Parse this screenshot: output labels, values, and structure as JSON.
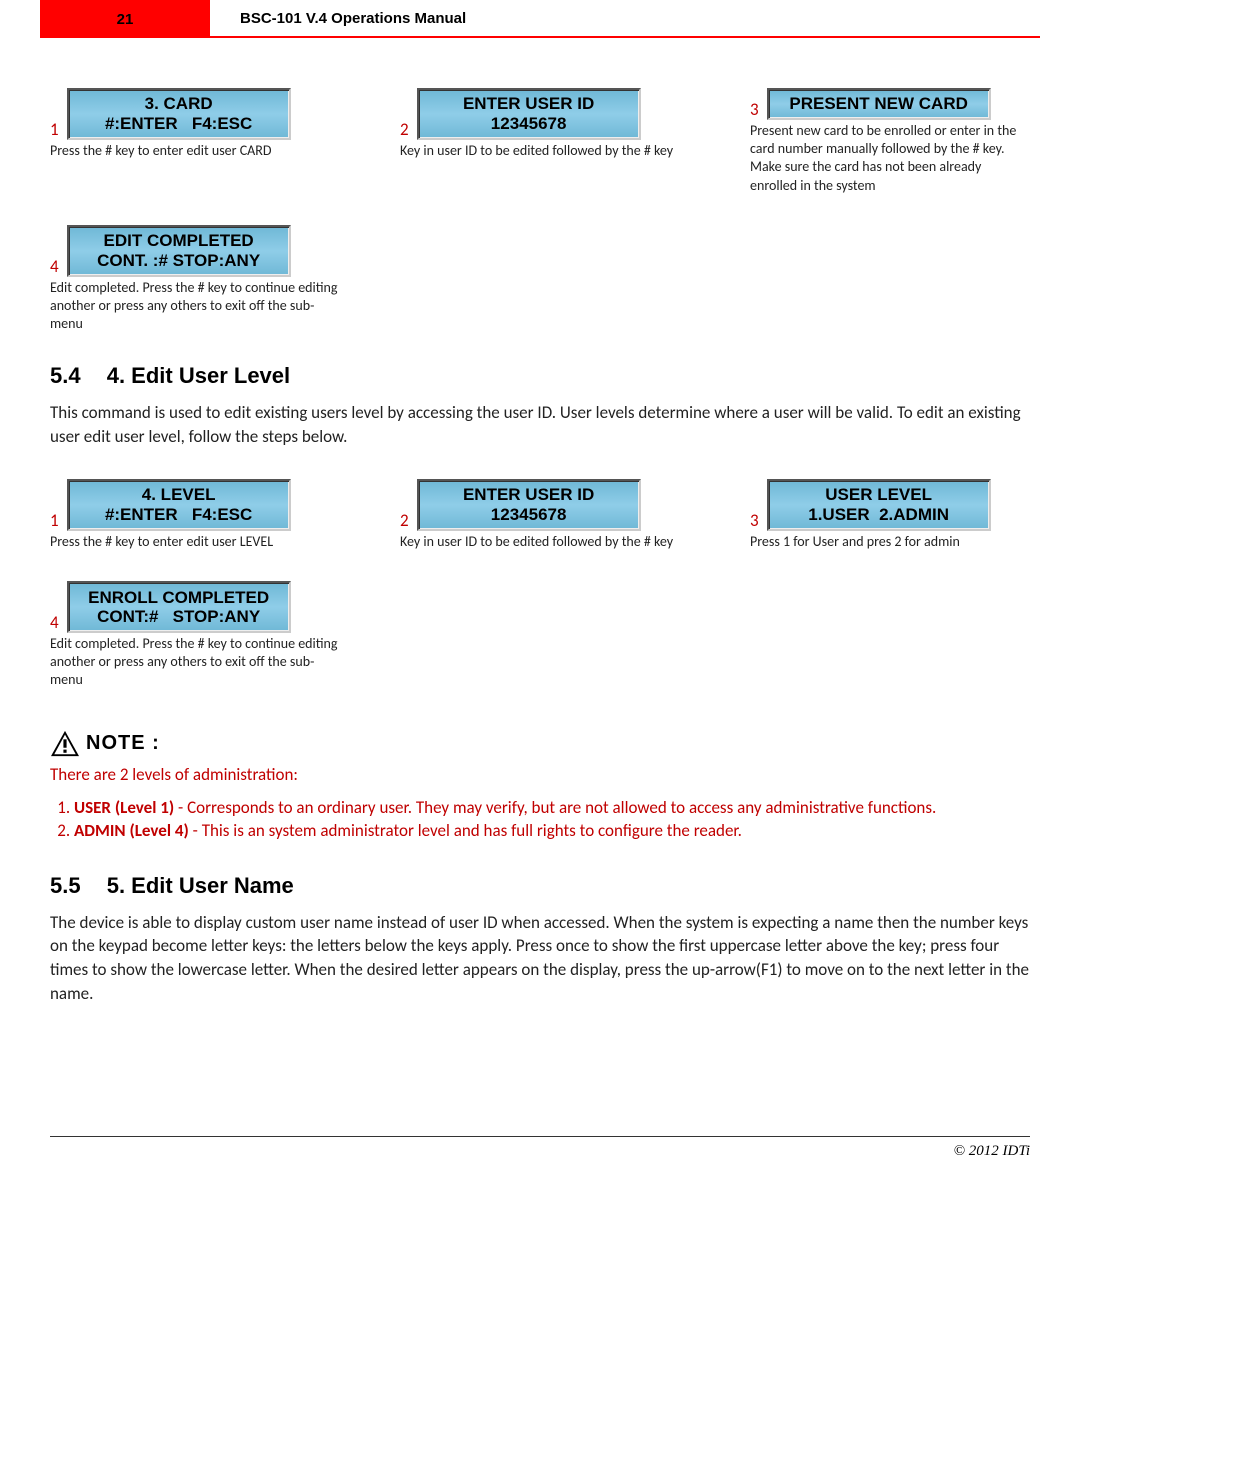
{
  "header": {
    "page_number": "21",
    "title": "BSC-101 V.4 Operations Manual"
  },
  "section_card": {
    "steps": [
      {
        "num": "1",
        "lcd_line1": "3. CARD",
        "lcd_line2": "#:ENTER   F4:ESC",
        "caption": "Press the # key to enter edit  user CARD"
      },
      {
        "num": "2",
        "lcd_line1": "ENTER USER ID",
        "lcd_line2": "12345678",
        "caption": "Key in user ID to be edited followed by the # key"
      },
      {
        "num": "3",
        "lcd_line1": "PRESENT NEW CARD",
        "lcd_line2": "",
        "caption": "Present new card to be enrolled or enter in the card number manually followed by the # key. Make sure the card has not been already enrolled in the system"
      },
      {
        "num": "4",
        "lcd_line1": "EDIT COMPLETED",
        "lcd_line2": "CONT. :# STOP:ANY",
        "caption": "Edit completed. Press the # key to continue editing another or press any others to exit off the sub-menu"
      }
    ]
  },
  "section_5_4": {
    "heading_num": "5.4",
    "heading_text": "4. Edit User Level",
    "body": "This command is used to edit existing users level by accessing the user ID. User levels determine where a user will be valid. To edit an existing user edit user level, follow the steps below.",
    "steps": [
      {
        "num": "1",
        "lcd_line1": "4. LEVEL",
        "lcd_line2": "#:ENTER   F4:ESC",
        "caption": "Press the # key to enter edit user LEVEL"
      },
      {
        "num": "2",
        "lcd_line1": "ENTER USER ID",
        "lcd_line2": "12345678",
        "caption": "Key in user ID to be edited followed by the # key"
      },
      {
        "num": "3",
        "lcd_line1": "USER LEVEL",
        "lcd_line2": "1.USER  2.ADMIN",
        "caption": "Press 1 for User and pres 2 for admin"
      },
      {
        "num": "4",
        "lcd_line1": "ENROLL COMPLETED",
        "lcd_line2": "CONT:#   STOP:ANY",
        "caption": "Edit completed. Press the # key to continue editing another or press any others to exit off the sub-menu"
      }
    ]
  },
  "note": {
    "label": "NOTE :",
    "intro": "There are 2 levels of administration:",
    "items": [
      {
        "bold": "USER (Level 1)",
        "rest": " - Corresponds to an ordinary user. They may verify, but are not allowed to access any administrative functions."
      },
      {
        "bold": "ADMIN (Level 4)",
        "rest": " - This is an system administrator level and has full rights to configure the reader."
      }
    ]
  },
  "section_5_5": {
    "heading_num": "5.5",
    "heading_text": "5. Edit User Name",
    "body": "The device is able to display custom user name instead of user ID when accessed. When the system is expecting a name then the number keys on the keypad become letter keys: the letters below the keys apply. Press once to show the first uppercase letter above the key; press four times to show  the lowercase letter. When the desired letter appears on the display, press the up-arrow(F1) to move on to the next letter in the name."
  },
  "footer": {
    "copyright": "© 2012 IDTi"
  }
}
